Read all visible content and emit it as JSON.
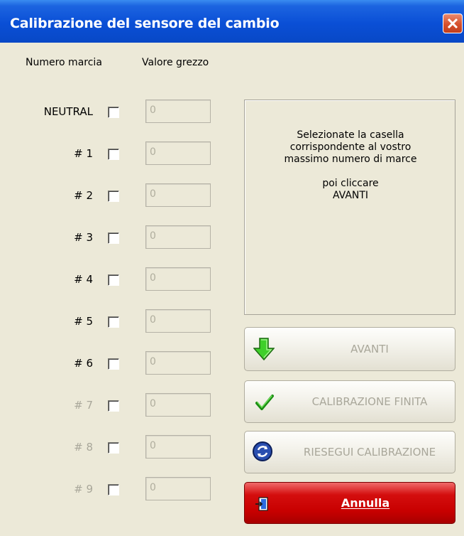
{
  "window": {
    "title": "Calibrazione del sensore del cambio"
  },
  "headers": {
    "gear_number": "Numero marcia",
    "raw_value": "Valore grezzo"
  },
  "gears": [
    {
      "label": "NEUTRAL",
      "value": "0",
      "enabled": true,
      "checked": false
    },
    {
      "label": "# 1",
      "value": "0",
      "enabled": true,
      "checked": false
    },
    {
      "label": "# 2",
      "value": "0",
      "enabled": true,
      "checked": false
    },
    {
      "label": "# 3",
      "value": "0",
      "enabled": true,
      "checked": false
    },
    {
      "label": "# 4",
      "value": "0",
      "enabled": true,
      "checked": false
    },
    {
      "label": "# 5",
      "value": "0",
      "enabled": true,
      "checked": false
    },
    {
      "label": "# 6",
      "value": "0",
      "enabled": true,
      "checked": false
    },
    {
      "label": "# 7",
      "value": "0",
      "enabled": false,
      "checked": false
    },
    {
      "label": "# 8",
      "value": "0",
      "enabled": false,
      "checked": false
    },
    {
      "label": "# 9",
      "value": "0",
      "enabled": false,
      "checked": false
    }
  ],
  "info": {
    "line1": "Selezionate la casella",
    "line2": "corrispondente al vostro",
    "line3": "massimo numero di marce",
    "line4": "poi cliccare",
    "line5": "AVANTI"
  },
  "buttons": {
    "next": {
      "label": "AVANTI",
      "icon": "arrow-down-icon"
    },
    "finish": {
      "label": "CALIBRAZIONE FINITA",
      "icon": "checkmark-icon"
    },
    "redo": {
      "label": "RIESEGUI CALIBRAZIONE",
      "icon": "refresh-icon"
    },
    "cancel": {
      "label": "Annulla",
      "icon": "exit-door-icon"
    }
  },
  "colors": {
    "title_bar": "#0a4fd6",
    "window_bg": "#ece9d8",
    "cancel_bg": "#c80000",
    "disabled_text": "#a9a79a"
  }
}
